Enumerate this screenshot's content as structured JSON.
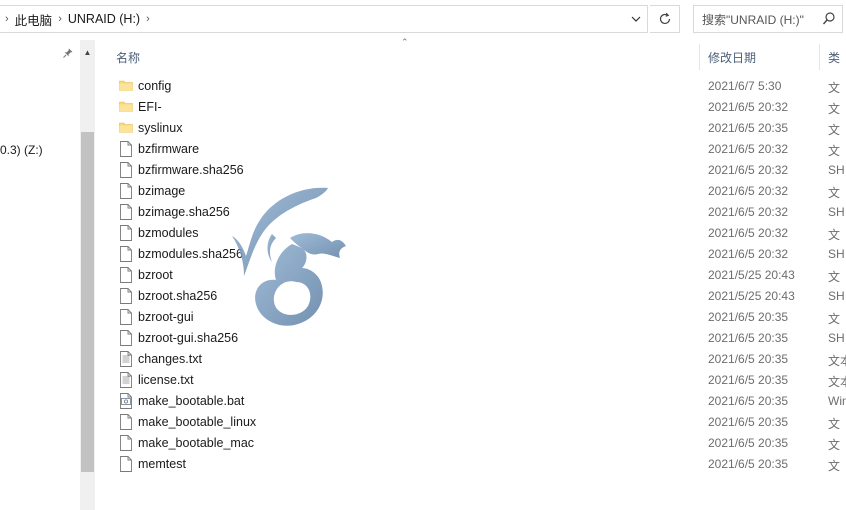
{
  "address": {
    "breadcrumbs": [
      "此电脑",
      "UNRAID (H:)"
    ],
    "search_placeholder": "搜索\"UNRAID (H:)\""
  },
  "nav": {
    "partial_item": "0.3) (Z:)"
  },
  "columns": {
    "name": "名称",
    "date": "修改日期",
    "type": "类"
  },
  "files": [
    {
      "name": "config",
      "kind": "folder",
      "date": "2021/6/7 5:30",
      "type": "文"
    },
    {
      "name": "EFI-",
      "kind": "folder",
      "date": "2021/6/5 20:32",
      "type": "文"
    },
    {
      "name": "syslinux",
      "kind": "folder",
      "date": "2021/6/5 20:35",
      "type": "文"
    },
    {
      "name": "bzfirmware",
      "kind": "file",
      "date": "2021/6/5 20:32",
      "type": "文"
    },
    {
      "name": "bzfirmware.sha256",
      "kind": "file",
      "date": "2021/6/5 20:32",
      "type": "SH"
    },
    {
      "name": "bzimage",
      "kind": "file",
      "date": "2021/6/5 20:32",
      "type": "文"
    },
    {
      "name": "bzimage.sha256",
      "kind": "file",
      "date": "2021/6/5 20:32",
      "type": "SH"
    },
    {
      "name": "bzmodules",
      "kind": "file",
      "date": "2021/6/5 20:32",
      "type": "文"
    },
    {
      "name": "bzmodules.sha256",
      "kind": "file",
      "date": "2021/6/5 20:32",
      "type": "SH"
    },
    {
      "name": "bzroot",
      "kind": "file",
      "date": "2021/5/25 20:43",
      "type": "文"
    },
    {
      "name": "bzroot.sha256",
      "kind": "file",
      "date": "2021/5/25 20:43",
      "type": "SH"
    },
    {
      "name": "bzroot-gui",
      "kind": "file",
      "date": "2021/6/5 20:35",
      "type": "文"
    },
    {
      "name": "bzroot-gui.sha256",
      "kind": "file",
      "date": "2021/6/5 20:35",
      "type": "SH"
    },
    {
      "name": "changes.txt",
      "kind": "text",
      "date": "2021/6/5 20:35",
      "type": "文本"
    },
    {
      "name": "license.txt",
      "kind": "text",
      "date": "2021/6/5 20:35",
      "type": "文本"
    },
    {
      "name": "make_bootable.bat",
      "kind": "bat",
      "date": "2021/6/5 20:35",
      "type": "Win"
    },
    {
      "name": "make_bootable_linux",
      "kind": "file",
      "date": "2021/6/5 20:35",
      "type": "文"
    },
    {
      "name": "make_bootable_mac",
      "kind": "file",
      "date": "2021/6/5 20:35",
      "type": "文"
    },
    {
      "name": "memtest",
      "kind": "file",
      "date": "2021/6/5 20:35",
      "type": "文"
    }
  ],
  "colors": {
    "folder": "#f8d775",
    "header_text": "#4c607a",
    "watermark": "#6f8fb1"
  }
}
